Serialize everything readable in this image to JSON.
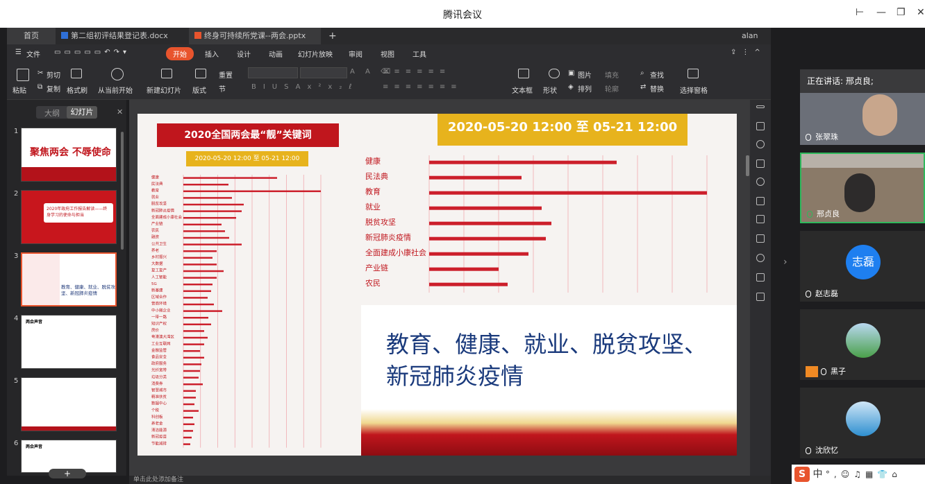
{
  "window": {
    "title": "腾讯会议"
  },
  "tabs": [
    {
      "label": "首页"
    },
    {
      "label": "第二组初评结果登记表.docx"
    },
    {
      "label": "终身可持续所党课--两会.pptx"
    }
  ],
  "user": "alan",
  "menu": {
    "file": "文件",
    "items": [
      "开始",
      "插入",
      "设计",
      "动画",
      "幻灯片放映",
      "审阅",
      "视图",
      "工具"
    ]
  },
  "ribbon": {
    "paste": "粘贴",
    "cut": "剪切",
    "copy": "复制",
    "format_painter": "格式刷",
    "play_from_current": "从当前开始",
    "new_slide": "新建幻灯片",
    "layout": "版式",
    "section": "节",
    "reset": "重置",
    "textbox": "文本框",
    "shape": "形状",
    "picture": "图片",
    "arrange": "排列",
    "fill": "填充",
    "outline": "轮廓",
    "find": "查找",
    "replace": "替换",
    "select_pane": "选择窗格"
  },
  "panel": {
    "tab_outline": "大纲",
    "tab_slides": "幻灯片",
    "add_button": "+"
  },
  "thumbnails": [
    {
      "num": "1",
      "title": "聚焦两会 不辱使命"
    },
    {
      "num": "2",
      "title": "2020年政府工作报告解读——终身学习的使命与担当"
    },
    {
      "num": "3",
      "title": "教育、健康、就业、脱贫攻坚、新冠肺炎疫情"
    },
    {
      "num": "4",
      "title": "两会声音"
    },
    {
      "num": "5",
      "title": ""
    },
    {
      "num": "6",
      "title": "两会声音"
    }
  ],
  "slide": {
    "left_title": "2020全国两会最“靓”关键词",
    "left_date": "2020-05-20 12:00 至 05-21 12:00",
    "right_date": "2020-05-20 12:00 至 05-21 12:00",
    "callout": "教育、健康、就业、脱贫攻坚、新冠肺炎疫情"
  },
  "chart_data": [
    {
      "type": "bar",
      "orientation": "horizontal",
      "title": "",
      "categories": [
        "健康",
        "民法典",
        "教育",
        "就业",
        "脱贫攻坚",
        "新冠肺炎疫情",
        "全面建成小康社会",
        "产业链",
        "农民"
      ],
      "values": [
        270,
        133,
        400,
        162,
        176,
        168,
        143,
        100,
        113
      ]
    },
    {
      "type": "bar",
      "orientation": "horizontal",
      "title": "",
      "categories": [
        "健康",
        "民法典",
        "教育",
        "就业",
        "脱贫攻坚",
        "新冠肺炎疫情",
        "全面建成小康社会",
        "产业链",
        "农民",
        "融资",
        "公共卫生",
        "养老",
        "乡村振兴",
        "大数据",
        "复工复产",
        "人工智能",
        "5G",
        "新基建",
        "区域合作",
        "营商环境",
        "中小微企业",
        "一带一路",
        "知识产权",
        "房价",
        "粤港澳大湾区",
        "工业互联网",
        "金融监管",
        "食品安全",
        "政府服务",
        "光纤宽带",
        "垃圾分类",
        "消费券",
        "智慧城市",
        "精准扶贫",
        "数据中心",
        "个税",
        "科创板",
        "养老金",
        "清洁能源",
        "新冠疫苗",
        "节能减排"
      ],
      "values": [
        135,
        65,
        198,
        70,
        87,
        84,
        76,
        55,
        60,
        66,
        84,
        48,
        42,
        48,
        58,
        48,
        42,
        40,
        35,
        44,
        56,
        36,
        40,
        30,
        35,
        30,
        24,
        30,
        26,
        24,
        22,
        28,
        18,
        18,
        16,
        22,
        14,
        16,
        14,
        12,
        10
      ]
    }
  ],
  "meeting": {
    "speaking_label": "正在讲话: 邢贞良;",
    "participants": [
      {
        "name": "张翠珠"
      },
      {
        "name": "邢贞良"
      },
      {
        "name": "赵志磊",
        "avatar_text": "志磊"
      },
      {
        "name": "黑子"
      },
      {
        "name": "沈欣忆"
      }
    ]
  },
  "status_bar": "单击此处添加备注",
  "ime": {
    "label": "中"
  },
  "colors": {
    "accent": "#e8542d",
    "slide_red": "#c0161d",
    "gold": "#e7b31d",
    "blue_avatar": "#1e7ff0"
  }
}
